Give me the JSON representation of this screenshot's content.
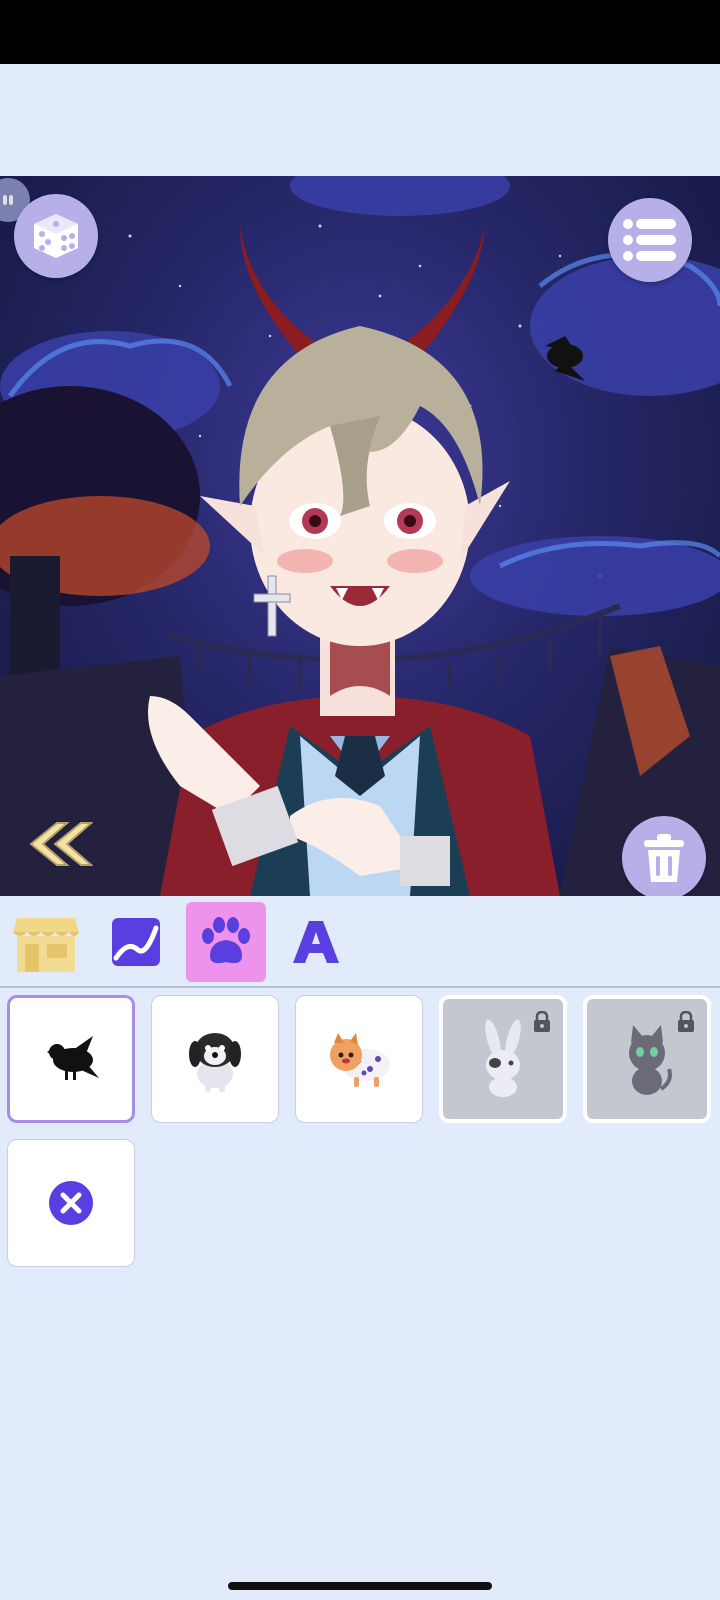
{
  "colors": {
    "accent_purple": "#5a3fe0",
    "active_tab_pink": "#ee93ec",
    "background": "#e2ebfb",
    "round_button": "#b6afe8"
  },
  "toolbar": {
    "random_icon": "dice-icon",
    "menu_icon": "list-menu-icon",
    "back_icon": "double-chevron-left-icon",
    "delete_icon": "trash-icon"
  },
  "tabs": [
    {
      "name": "shop",
      "icon": "shop-icon",
      "active": false
    },
    {
      "name": "background",
      "icon": "landscape-icon",
      "active": false
    },
    {
      "name": "pets",
      "icon": "paw-icon",
      "active": true
    },
    {
      "name": "text",
      "icon": "letter-a-icon",
      "active": false
    }
  ],
  "items": [
    {
      "name": "crow",
      "icon": "crow-icon",
      "selected": true,
      "locked": false
    },
    {
      "name": "puppy",
      "icon": "puppy-icon",
      "selected": false,
      "locked": false
    },
    {
      "name": "pomeranian",
      "icon": "pomeranian-icon",
      "selected": false,
      "locked": false
    },
    {
      "name": "bunny",
      "icon": "bunny-icon",
      "selected": false,
      "locked": true
    },
    {
      "name": "cat",
      "icon": "cat-icon",
      "selected": false,
      "locked": true
    },
    {
      "name": "none",
      "icon": "remove-icon",
      "selected": false,
      "locked": false
    }
  ]
}
